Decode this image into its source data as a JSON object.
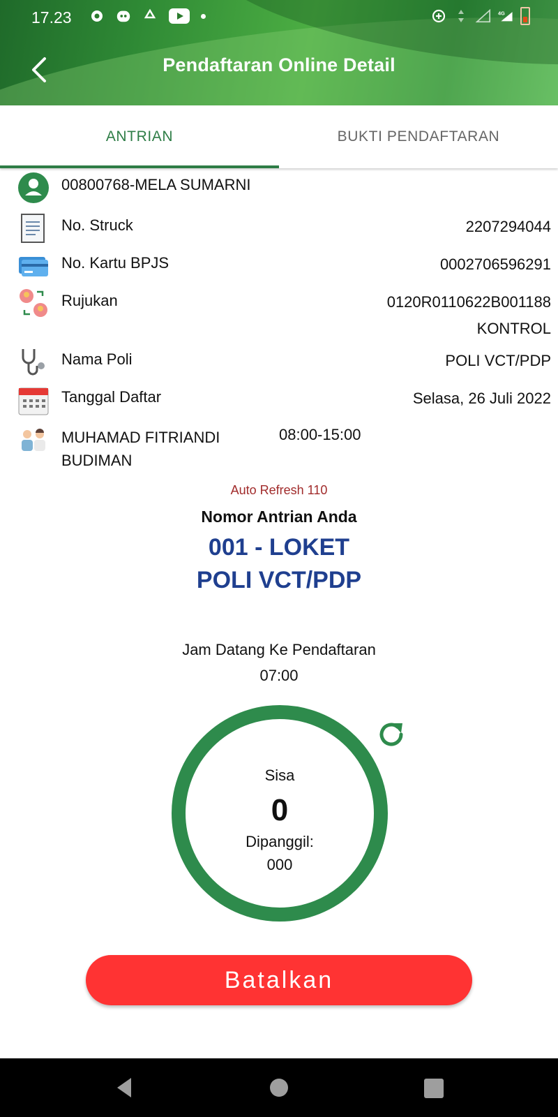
{
  "status_bar": {
    "time": "17.23",
    "network": "4G"
  },
  "app_bar": {
    "title": "Pendaftaran Online Detail"
  },
  "tabs": [
    {
      "label": "ANTRIAN",
      "active": true
    },
    {
      "label": "BUKTI PENDAFTARAN",
      "active": false
    }
  ],
  "patient": {
    "name": "00800768-MELA SUMARNI"
  },
  "info": {
    "struck": {
      "label": "No. Struck",
      "value": "2207294044"
    },
    "bpjs": {
      "label": "No. Kartu BPJS",
      "value": "0002706596291"
    },
    "rujukan": {
      "label": "Rujukan",
      "value": "0120R0110622B001188",
      "value2": "KONTROL"
    },
    "poli": {
      "label": "Nama Poli",
      "value": "POLI VCT/PDP"
    },
    "tanggal": {
      "label": "Tanggal Daftar",
      "value": "Selasa, 26 Juli 2022"
    },
    "dokter": {
      "name_line1": "MUHAMAD FITRIANDI",
      "name_line2": "BUDIMAN",
      "time": "08:00-15:00"
    }
  },
  "queue": {
    "auto_refresh": "Auto Refresh 110",
    "label": "Nomor Antrian Anda",
    "number": "001 - LOKET",
    "poli": "POLI VCT/PDP",
    "arrival_label": "Jam Datang Ke Pendaftaran",
    "arrival_time": "07:00",
    "remaining_label": "Sisa",
    "remaining_value": "0",
    "called_label": "Dipanggil:",
    "called_value": "000"
  },
  "actions": {
    "cancel_label": "Batalkan"
  },
  "colors": {
    "primary_green": "#2e7d46",
    "queue_blue": "#1f3f8f",
    "cancel_red": "#ff3333",
    "refresh_text": "#a12b2b"
  }
}
